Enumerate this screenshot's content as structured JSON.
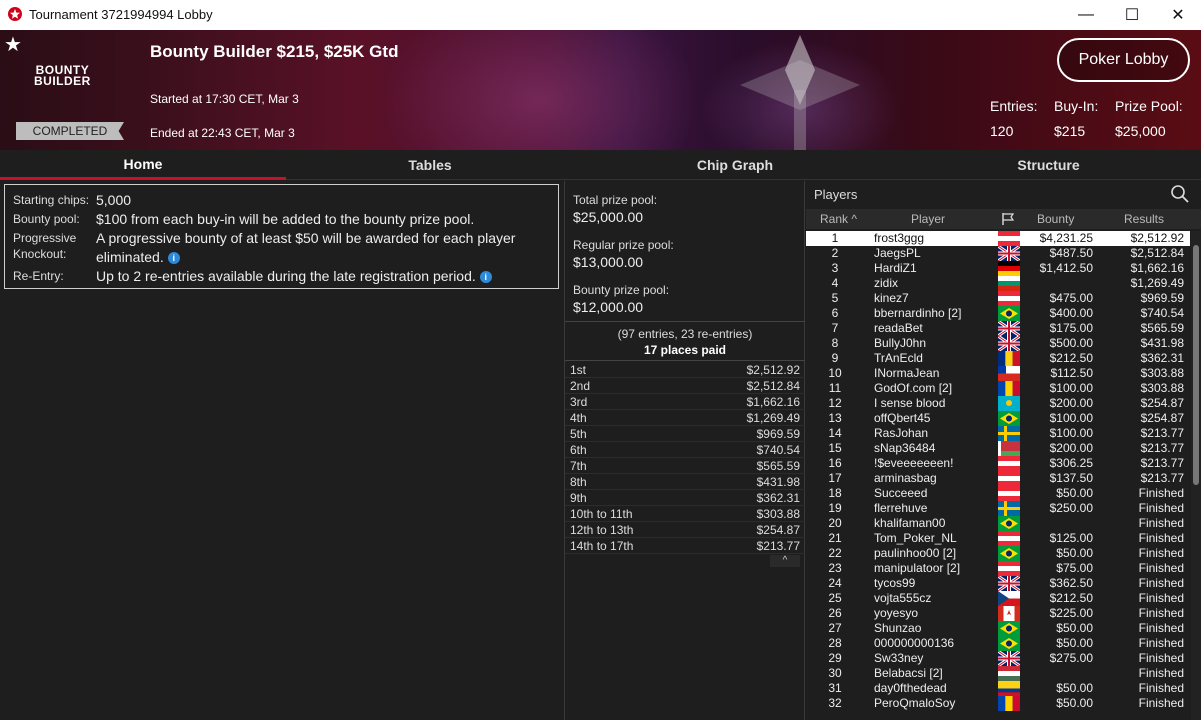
{
  "window": {
    "title": "Tournament 3721994994 Lobby",
    "minimize": "—",
    "maximize": "☐",
    "close": "✕"
  },
  "header": {
    "logo_line1": "BOUNTY",
    "logo_line2": "BUILDER",
    "status": "COMPLETED",
    "name": "Bounty Builder $215, $25K Gtd",
    "started": "Started at 17:30 CET, Mar 3",
    "ended": "Ended at 22:43 CET, Mar 3",
    "lobby_button": "Poker Lobby",
    "entries_label": "Entries:",
    "entries_value": "120",
    "buyin_label": "Buy-In:",
    "buyin_value": "$215",
    "prizepool_label": "Prize Pool:",
    "prizepool_value": "$25,000"
  },
  "tabs": [
    "Home",
    "Tables",
    "Chip Graph",
    "Structure"
  ],
  "info": {
    "starting_chips_label": "Starting chips:",
    "starting_chips_value": "5,000",
    "bounty_pool_label": "Bounty pool:",
    "bounty_pool_value": "$100 from each buy-in will be added to the bounty prize pool.",
    "prog_label_1": "Progressive",
    "prog_label_2": "Knockout:",
    "prog_value_1": "A progressive bounty of at least $50 will be awarded for each player",
    "prog_value_2": "eliminated.",
    "reentry_label": "Re-Entry:",
    "reentry_value": "Up to 2 re-entries available during the late registration period.",
    "info_icon": "i"
  },
  "prize": {
    "total_label": "Total prize pool:",
    "total_value": "$25,000.00",
    "regular_label": "Regular prize pool:",
    "regular_value": "$13,000.00",
    "bounty_label": "Bounty prize pool:",
    "bounty_value": "$12,000.00",
    "entries_text": "(97 entries, 23 re-entries)",
    "places_text": "17 places paid",
    "payouts": [
      {
        "place": "1st",
        "amount": "$2,512.92"
      },
      {
        "place": "2nd",
        "amount": "$2,512.84"
      },
      {
        "place": "3rd",
        "amount": "$1,662.16"
      },
      {
        "place": "4th",
        "amount": "$1,269.49"
      },
      {
        "place": "5th",
        "amount": "$969.59"
      },
      {
        "place": "6th",
        "amount": "$740.54"
      },
      {
        "place": "7th",
        "amount": "$565.59"
      },
      {
        "place": "8th",
        "amount": "$431.98"
      },
      {
        "place": "9th",
        "amount": "$362.31"
      },
      {
        "place": "10th to 11th",
        "amount": "$303.88"
      },
      {
        "place": "12th to 13th",
        "amount": "$254.87"
      },
      {
        "place": "14th to 17th",
        "amount": "$213.77"
      }
    ]
  },
  "players": {
    "title": "Players",
    "col_rank": "Rank",
    "col_player": "Player",
    "col_bounty": "Bounty",
    "col_results": "Results",
    "rows": [
      {
        "rank": "1",
        "name": "frost3ggg",
        "flag": "at",
        "bounty": "$4,231.25",
        "result": "$2,512.92"
      },
      {
        "rank": "2",
        "name": "JaegsPL",
        "flag": "gb",
        "bounty": "$487.50",
        "result": "$2,512.84"
      },
      {
        "rank": "3",
        "name": "HardiZ1",
        "flag": "de",
        "bounty": "$1,412.50",
        "result": "$1,662.16"
      },
      {
        "rank": "4",
        "name": "zidix",
        "flag": "bg",
        "bounty": "",
        "result": "$1,269.49"
      },
      {
        "rank": "5",
        "name": "kinez7",
        "flag": "at",
        "bounty": "$475.00",
        "result": "$969.59"
      },
      {
        "rank": "6",
        "name": "bbernardinho [2]",
        "flag": "br",
        "bounty": "$400.00",
        "result": "$740.54"
      },
      {
        "rank": "7",
        "name": "readaBet",
        "flag": "gb",
        "bounty": "$175.00",
        "result": "$565.59"
      },
      {
        "rank": "8",
        "name": "BullyJ0hn",
        "flag": "gb",
        "bounty": "$500.00",
        "result": "$431.98"
      },
      {
        "rank": "9",
        "name": "TrAnEcld",
        "flag": "ro",
        "bounty": "$212.50",
        "result": "$362.31"
      },
      {
        "rank": "10",
        "name": "INormaJean",
        "flag": "cl",
        "bounty": "$112.50",
        "result": "$303.88"
      },
      {
        "rank": "11",
        "name": "GodOf.com [2]",
        "flag": "md",
        "bounty": "$100.00",
        "result": "$303.88"
      },
      {
        "rank": "12",
        "name": "I sense blood",
        "flag": "kz",
        "bounty": "$200.00",
        "result": "$254.87"
      },
      {
        "rank": "13",
        "name": "offQbert45",
        "flag": "br",
        "bounty": "$100.00",
        "result": "$254.87"
      },
      {
        "rank": "14",
        "name": "RasJohan",
        "flag": "se",
        "bounty": "$100.00",
        "result": "$213.77"
      },
      {
        "rank": "15",
        "name": "sNap36484",
        "flag": "by",
        "bounty": "$200.00",
        "result": "$213.77"
      },
      {
        "rank": "16",
        "name": "!$eveeeeeeen!",
        "flag": "at",
        "bounty": "$306.25",
        "result": "$213.77"
      },
      {
        "rank": "17",
        "name": "arminasbag",
        "flag": "at",
        "bounty": "$137.50",
        "result": "$213.77"
      },
      {
        "rank": "18",
        "name": "Succeeed",
        "flag": "at",
        "bounty": "$50.00",
        "result": "Finished"
      },
      {
        "rank": "19",
        "name": "flerrehuve",
        "flag": "se",
        "bounty": "$250.00",
        "result": "Finished"
      },
      {
        "rank": "20",
        "name": "khalifaman00",
        "flag": "br",
        "bounty": "",
        "result": "Finished"
      },
      {
        "rank": "21",
        "name": "Tom_Poker_NL",
        "flag": "at",
        "bounty": "$125.00",
        "result": "Finished"
      },
      {
        "rank": "22",
        "name": "paulinhoo00 [2]",
        "flag": "br",
        "bounty": "$50.00",
        "result": "Finished"
      },
      {
        "rank": "23",
        "name": "manipulatoor [2]",
        "flag": "at",
        "bounty": "$75.00",
        "result": "Finished"
      },
      {
        "rank": "24",
        "name": "tycos99",
        "flag": "gb",
        "bounty": "$362.50",
        "result": "Finished"
      },
      {
        "rank": "25",
        "name": "vojta555cz",
        "flag": "cz",
        "bounty": "$212.50",
        "result": "Finished"
      },
      {
        "rank": "26",
        "name": "yoyesyo",
        "flag": "ca",
        "bounty": "$225.00",
        "result": "Finished"
      },
      {
        "rank": "27",
        "name": "Shunzao",
        "flag": "br",
        "bounty": "$50.00",
        "result": "Finished"
      },
      {
        "rank": "28",
        "name": "000000000136",
        "flag": "br",
        "bounty": "$50.00",
        "result": "Finished"
      },
      {
        "rank": "29",
        "name": "Sw33ney",
        "flag": "gb",
        "bounty": "$275.00",
        "result": "Finished"
      },
      {
        "rank": "30",
        "name": "Belabacsi [2]",
        "flag": "hu",
        "bounty": "",
        "result": "Finished"
      },
      {
        "rank": "31",
        "name": "day0fthedead",
        "flag": "co",
        "bounty": "$50.00",
        "result": "Finished"
      },
      {
        "rank": "32",
        "name": "PeroQmaloSoy",
        "flag": "md",
        "bounty": "$50.00",
        "result": "Finished"
      }
    ]
  },
  "colors": {
    "accent": "#c8102e",
    "background": "#1e1e1e",
    "info_icon": "#2d8ad8"
  }
}
